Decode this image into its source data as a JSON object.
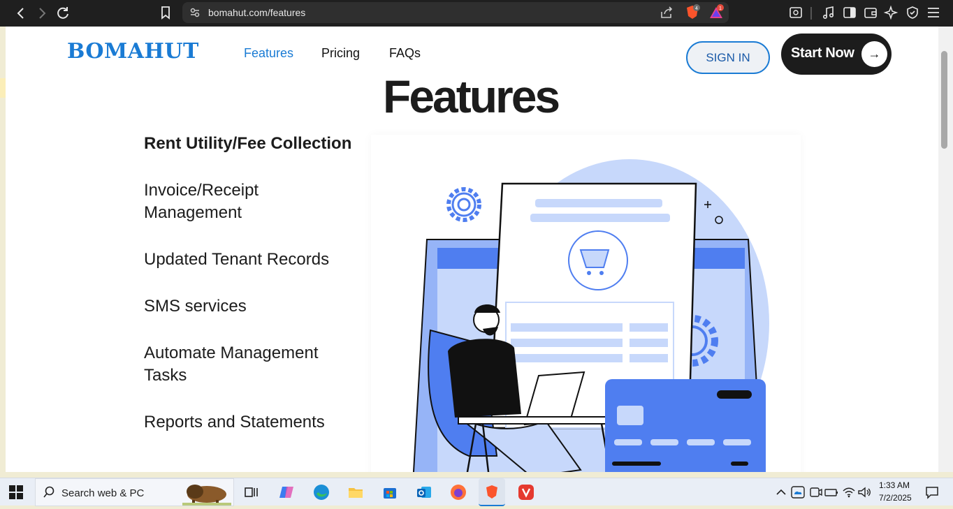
{
  "browser": {
    "url": "bomahut.com/features",
    "brave_badge": "4",
    "rewards_badge": "1"
  },
  "site": {
    "logo": "BOMAHUT",
    "nav": {
      "features": "Features",
      "pricing": "Pricing",
      "faqs": "FAQs"
    },
    "sign_in": "SIGN IN",
    "start_now": "Start Now",
    "start_arrow": "→"
  },
  "page": {
    "title": "Features",
    "features": [
      "Rent Utility/Fee Collection",
      "Invoice/Receipt Management",
      "Updated Tenant Records",
      "SMS services",
      "Automate Management Tasks",
      "Reports and Statements"
    ]
  },
  "taskbar": {
    "search_placeholder": "Search web & PC",
    "time": "1:33 AM",
    "date": "7/2/2025"
  },
  "colors": {
    "brand_blue": "#1a7bd4",
    "illustration_blue": "#4f7ef0",
    "illustration_light": "#c7d8fb",
    "dark": "#1c1c1c"
  },
  "icons": [
    "back-arrow-icon",
    "forward-arrow-icon",
    "reload-icon",
    "bookmark-icon",
    "site-info-icon",
    "share-icon",
    "brave-shields-icon",
    "brave-rewards-icon",
    "sidebar-icon",
    "music-icon",
    "wallet-icon",
    "leo-ai-icon",
    "vpn-icon",
    "menu-icon",
    "windows-start-icon",
    "search-icon"
  ]
}
